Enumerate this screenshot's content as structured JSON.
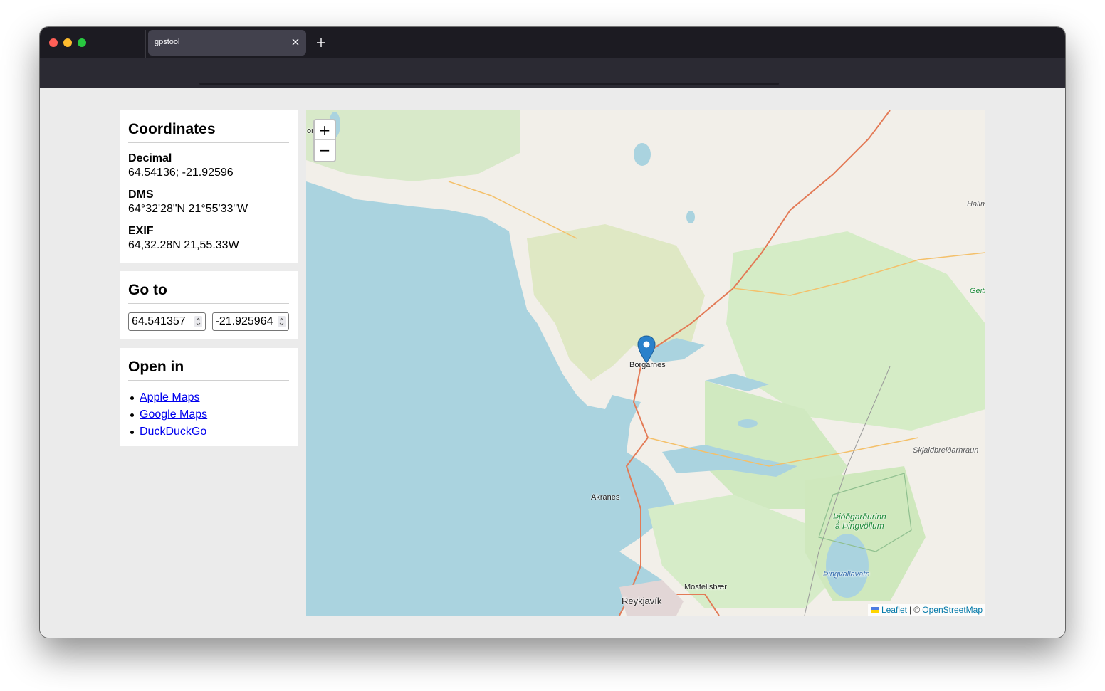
{
  "browser": {
    "tab_title": "gpstool",
    "close_icon": "close-icon",
    "new_tab_icon": "plus-icon"
  },
  "coordinates": {
    "title": "Coordinates",
    "decimal_label": "Decimal",
    "decimal_value": "64.54136; -21.92596",
    "dms_label": "DMS",
    "dms_value": "64°32'28\"N 21°55'33\"W",
    "exif_label": "EXIF",
    "exif_value": "64,32.28N 21,55.33W"
  },
  "goto": {
    "title": "Go to",
    "lat_value": "64.541357",
    "lon_value": "-21.925964"
  },
  "open_in": {
    "title": "Open in",
    "links": [
      "Apple Maps",
      "Google Maps",
      "DuckDuckGo"
    ]
  },
  "map": {
    "zoom_in": "+",
    "zoom_out": "−",
    "marker_label": "Borgarnes",
    "attribution_leaflet": "Leaflet",
    "attribution_sep": "| ©",
    "attribution_osm": "OpenStreetMap",
    "labels": {
      "akranes": "Akranes",
      "reykjavik": "Reykjavík",
      "mosfellsbaer": "Mosfellsbær",
      "park_line1": "Þjóðgarðurinn",
      "park_line2": "á Þingvöllum",
      "thingvallavatn": "Þingvallavatn",
      "skjaldbreid": "Skjaldbreiðarhraun",
      "hallmu": "Hallmu",
      "geitl": "Geitl",
      "or": "or"
    }
  },
  "colors": {
    "water": "#aad3df",
    "land": "#f2efe9",
    "link": "#0000ee",
    "marker": "#2a81cb"
  }
}
